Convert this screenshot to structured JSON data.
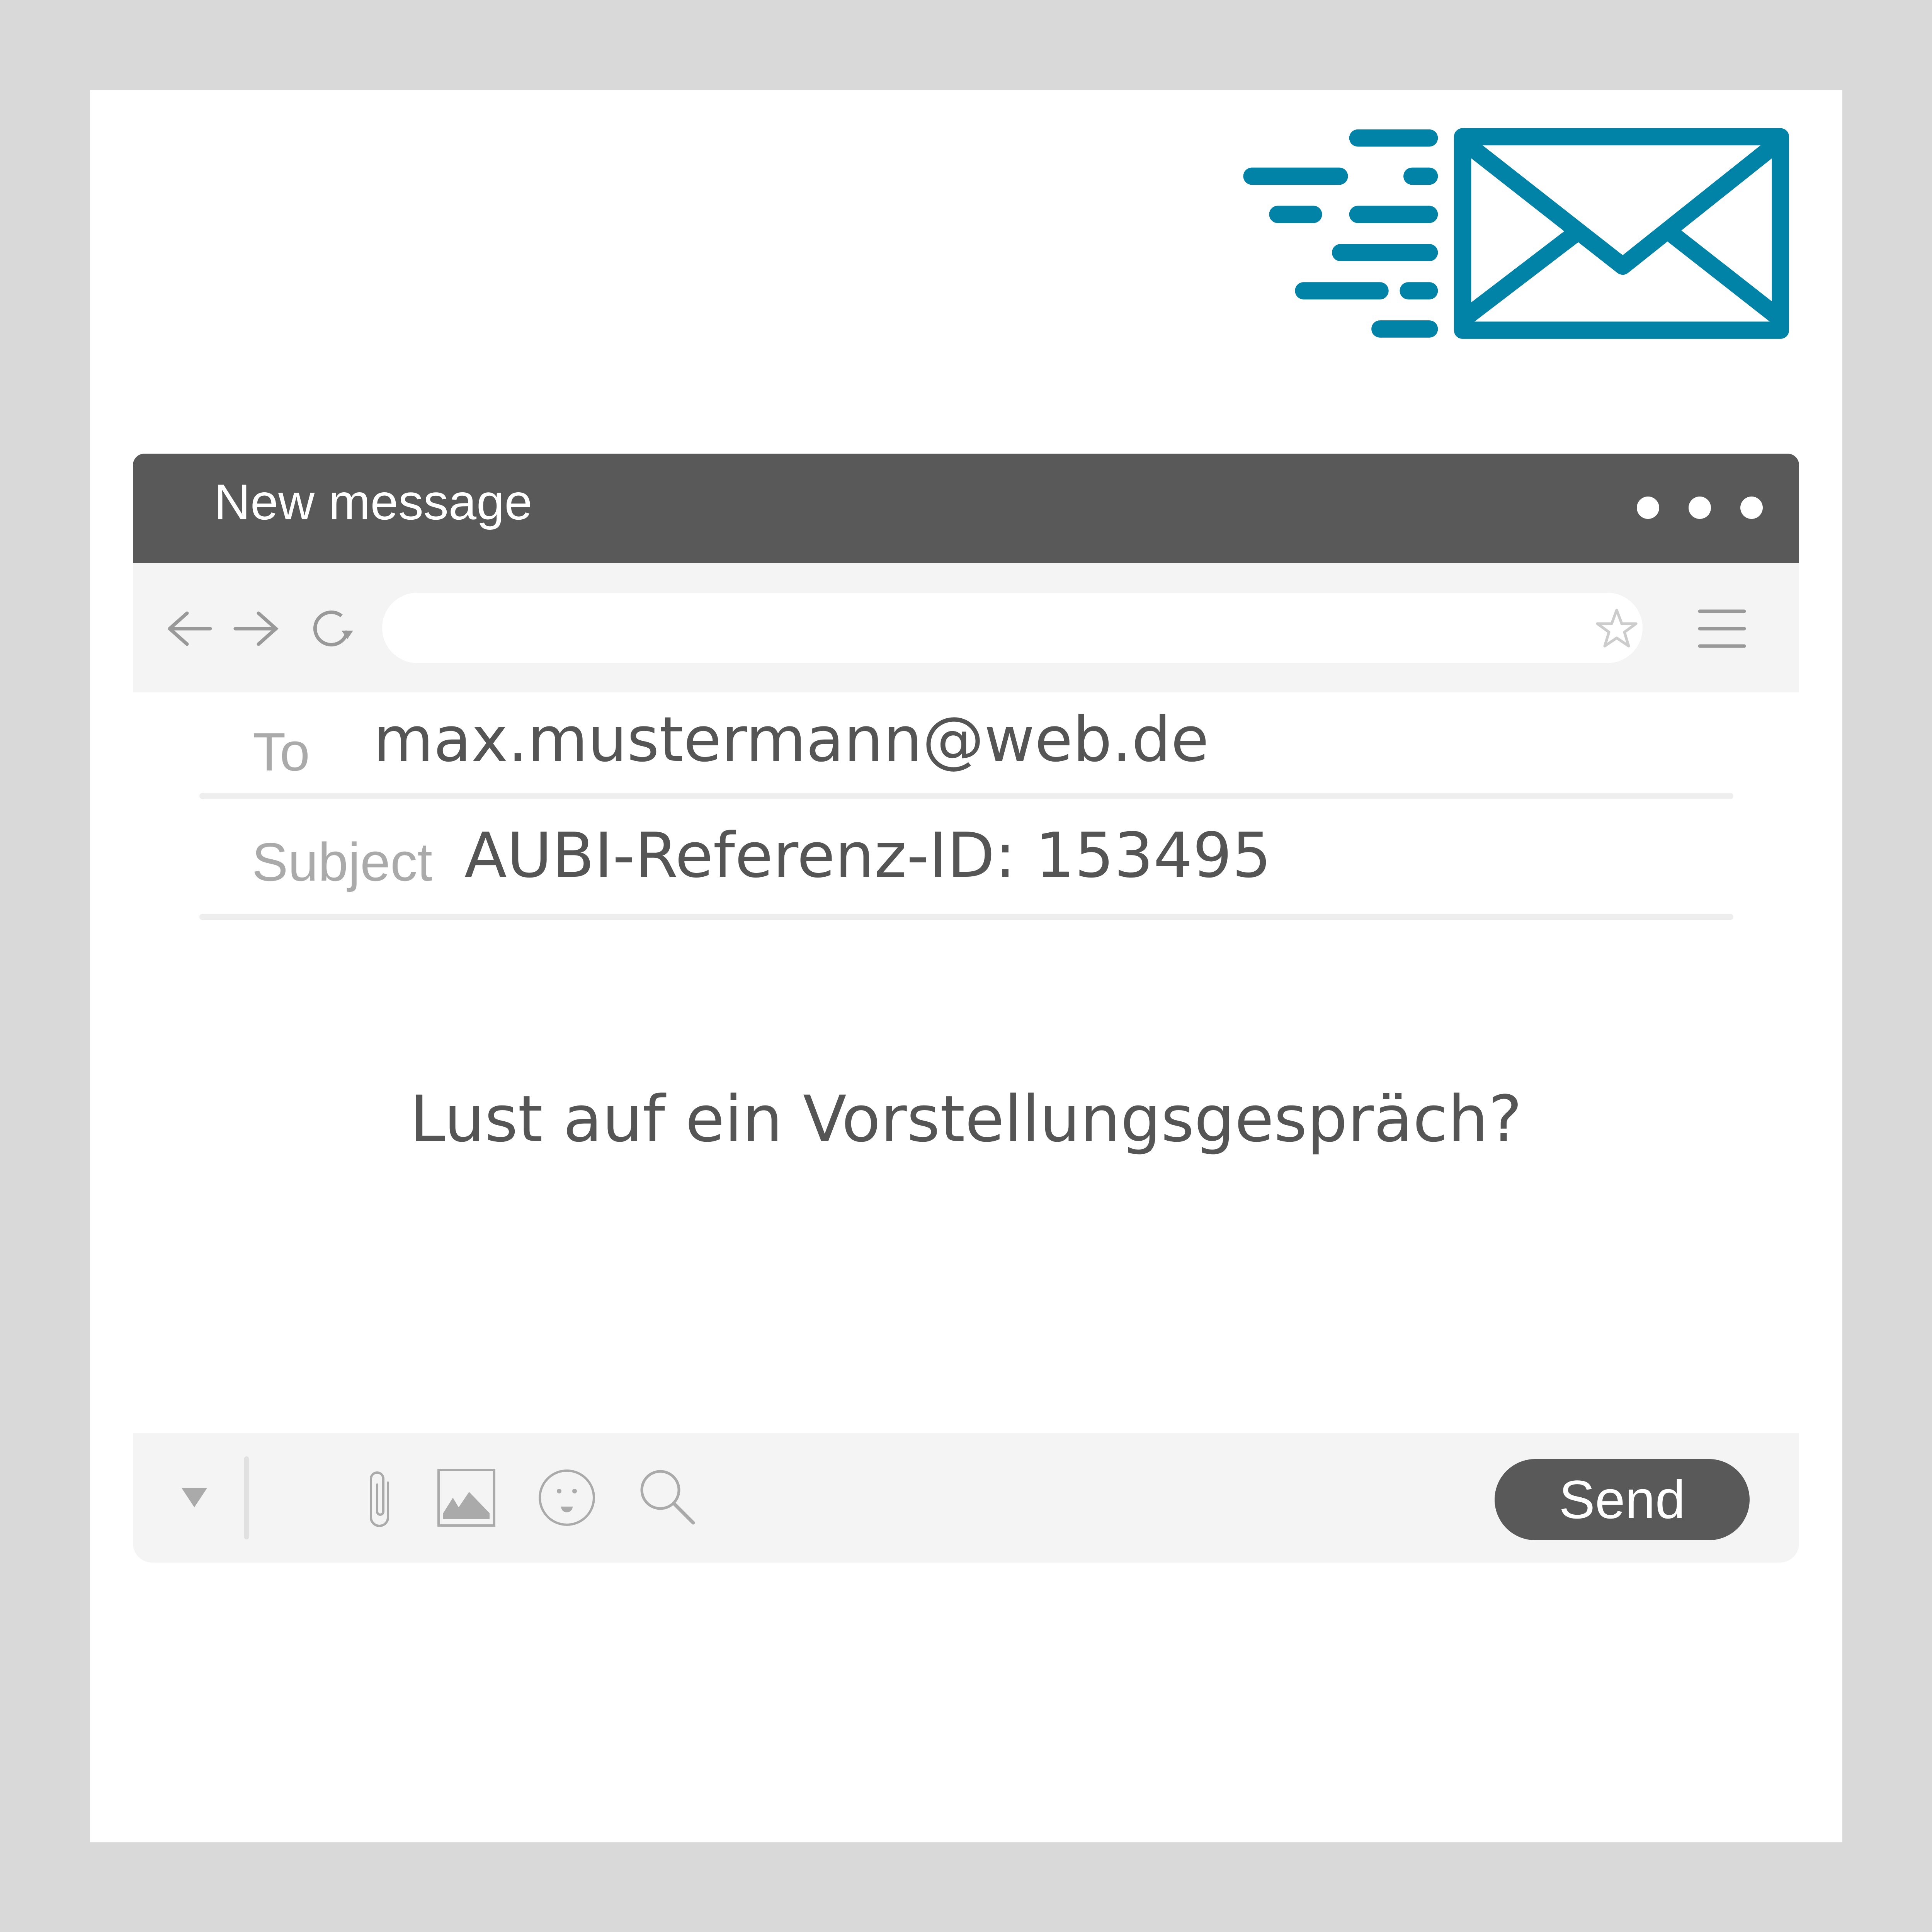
{
  "colors": {
    "accent": "#0083a6",
    "titlebar": "#595959",
    "toolbar": "#f4f4f4"
  },
  "window": {
    "title": "New message",
    "menu_icon": "more-dots-icon"
  },
  "toolbar": {
    "icons": [
      "back-arrow-icon",
      "forward-arrow-icon",
      "refresh-icon",
      "star-icon",
      "hamburger-menu-icon"
    ],
    "address_value": ""
  },
  "fields": {
    "to_label": "To",
    "to_value": "max.mustermann@web.de",
    "subject_label": "Subject",
    "subject_value": "AUBI-Referenz-ID: 153495"
  },
  "body": {
    "text": "Lust auf ein Vorstellungsgespräch?"
  },
  "bottom": {
    "icons": [
      "dropdown-triangle-icon",
      "paperclip-icon",
      "image-icon",
      "emoji-icon",
      "search-icon"
    ],
    "send_label": "Send"
  },
  "decoration": {
    "icon": "fast-mail-envelope-icon"
  }
}
